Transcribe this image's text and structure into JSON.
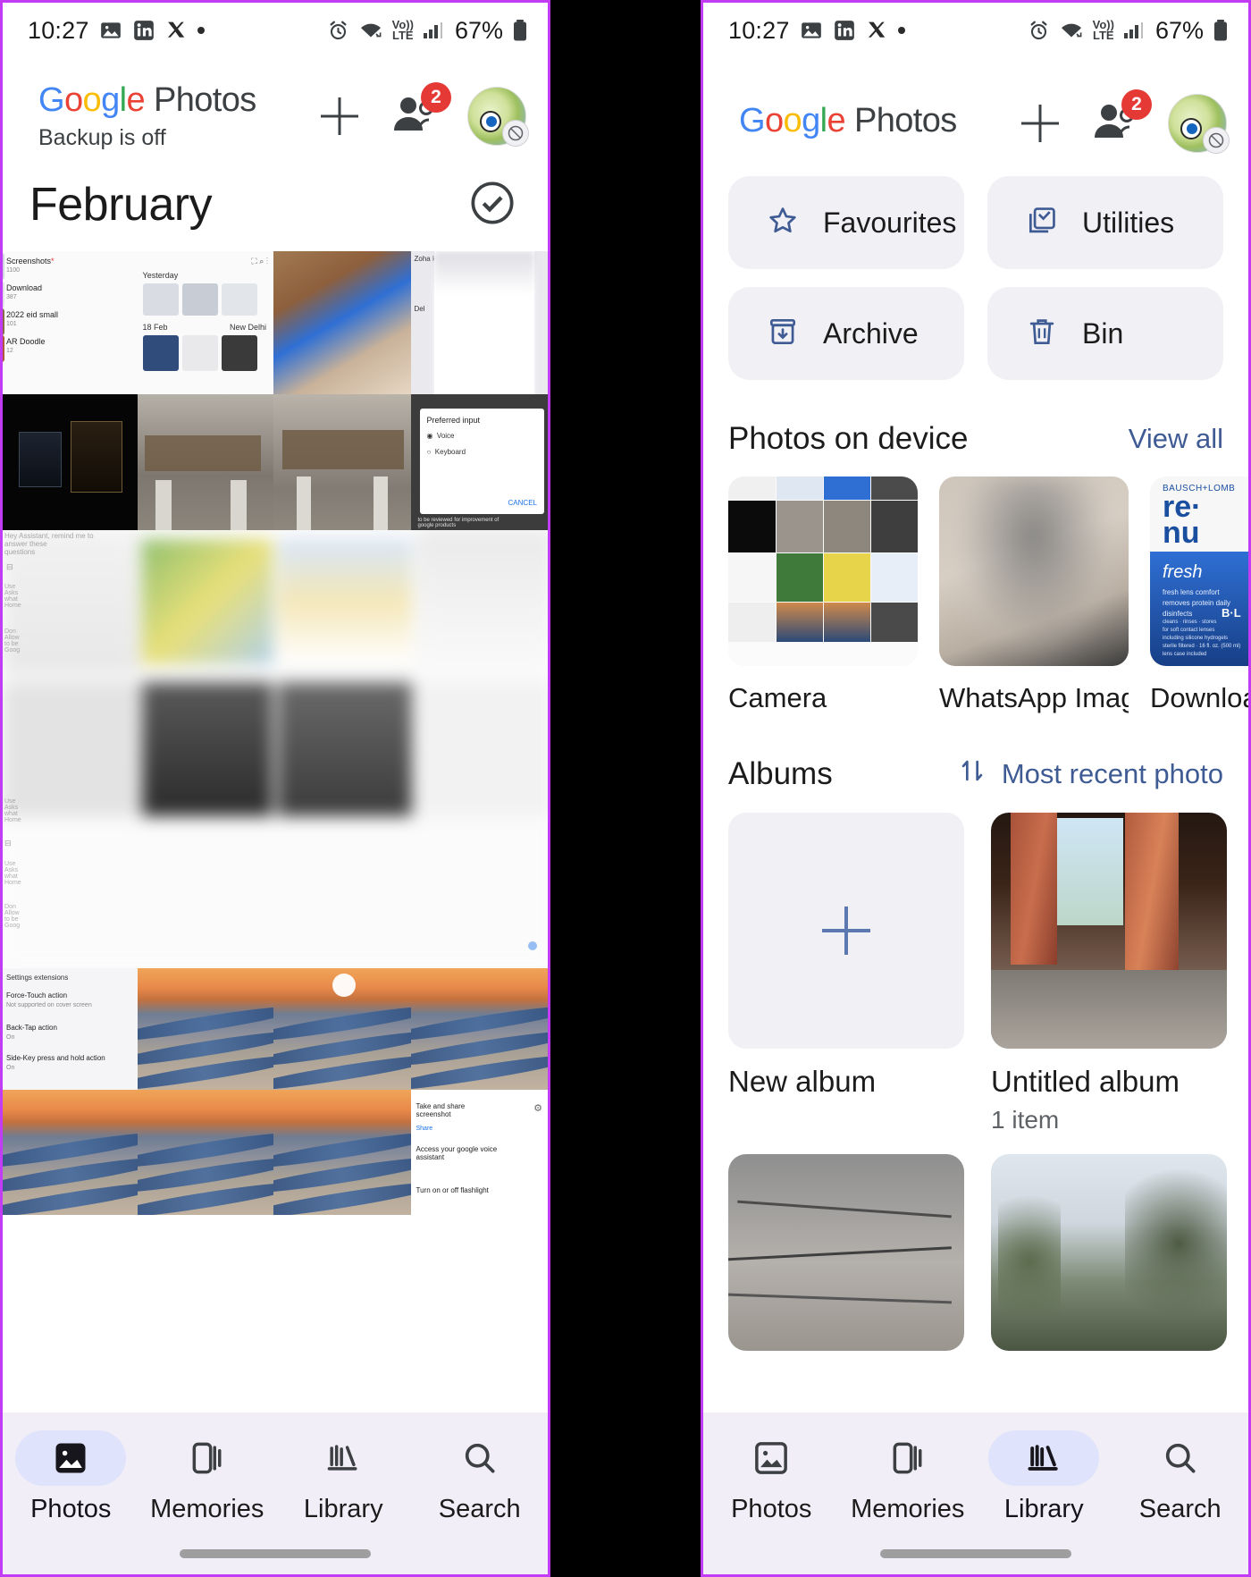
{
  "statusbar": {
    "time": "10:27",
    "battery_percent": "67%",
    "network_label": "LTE",
    "volte_label": "Vo))",
    "icons": [
      "photos-notification-icon",
      "linkedin-icon",
      "x-twitter-icon",
      "more-dot-icon",
      "alarm-icon",
      "wifi-icon",
      "volte-icon",
      "signal-icon",
      "battery-icon"
    ]
  },
  "appbar": {
    "brand_google": "Google",
    "brand_product": "Photos",
    "backup_status": "Backup is off",
    "add_label": "+",
    "share_badge": "2"
  },
  "left_panel": {
    "month_title": "February",
    "select_icon": "check-circle-icon",
    "tiles": [
      {
        "name": "screenshots-folder-list",
        "labels": [
          "Screenshots",
          "1100",
          "Download",
          "387",
          "2022 eid small",
          "101",
          "AR Doodle",
          "12"
        ]
      },
      {
        "name": "photos-grid-screenshot",
        "labels": [
          "Yesterday",
          "18 Feb",
          "New Delhi"
        ]
      },
      {
        "name": "blue-bag-photo",
        "labels": []
      },
      {
        "name": "chat-screenshot",
        "labels": [
          "Zoho h...",
          "Del"
        ]
      },
      {
        "name": "perfume-box-photo",
        "labels": []
      },
      {
        "name": "construction-site-photo",
        "labels": []
      },
      {
        "name": "construction-site-photo-2",
        "labels": []
      },
      {
        "name": "preferred-input-dialog",
        "labels": [
          "Preferred input",
          "Voice",
          "Keyboard",
          "CANCEL"
        ]
      },
      {
        "name": "blurred-settings-screenshot",
        "labels": []
      },
      {
        "name": "settings-extension-screenshot",
        "labels": [
          "Settings extensions",
          "Force-Touch action",
          "Not supported on cover screen",
          "Back-Tap action",
          "On",
          "Side-Key press and hold action",
          "On"
        ]
      },
      {
        "name": "beach-sunset-photo",
        "labels": []
      },
      {
        "name": "beach-sunset-photo-2",
        "labels": []
      },
      {
        "name": "beach-sunset-photo-3",
        "labels": []
      },
      {
        "name": "beach-sunset-photo-4",
        "labels": []
      },
      {
        "name": "beach-sunset-photo-5",
        "labels": []
      },
      {
        "name": "beach-sunset-photo-6",
        "labels": []
      },
      {
        "name": "assistant-options-screenshot",
        "labels": [
          "Take and share screenshot",
          "Share",
          "Access your google voice assistant",
          "Turn on or off flashlight"
        ]
      }
    ]
  },
  "right_panel": {
    "chips": [
      {
        "label": "Favourites",
        "icon": "star-icon"
      },
      {
        "label": "Utilities",
        "icon": "utilities-checkbox-icon"
      },
      {
        "label": "Archive",
        "icon": "archive-icon"
      },
      {
        "label": "Bin",
        "icon": "trash-icon"
      }
    ],
    "device_section": {
      "title": "Photos on device",
      "action": "View all",
      "items": [
        {
          "name": "Camera"
        },
        {
          "name": "WhatsApp Imag..."
        },
        {
          "name": "Downloa"
        }
      ]
    },
    "albums_section": {
      "title": "Albums",
      "sort_label": "Most recent photo",
      "sort_icon": "sort-arrows-icon",
      "items": [
        {
          "name": "New album",
          "subtitle": "",
          "thumb": "new-album-plus"
        },
        {
          "name": "Untitled album",
          "subtitle": "1 item",
          "thumb": "curtain-window-photo"
        },
        {
          "name": "",
          "subtitle": "",
          "thumb": "rock-texture-photo"
        },
        {
          "name": "",
          "subtitle": "",
          "thumb": "trees-sky-photo"
        }
      ]
    }
  },
  "bottomnav": {
    "left_active": "Photos",
    "right_active": "Library",
    "items": [
      {
        "label": "Photos",
        "icon": "photos-icon"
      },
      {
        "label": "Memories",
        "icon": "memories-icon"
      },
      {
        "label": "Library",
        "icon": "library-icon"
      },
      {
        "label": "Search",
        "icon": "search-icon"
      }
    ]
  },
  "colors": {
    "accent_blue": "#4285F4",
    "badge_red": "#e53935",
    "chip_bg": "#f0f0f5",
    "nav_bg": "#f1eef7",
    "nav_active_pill": "#dfe3fb",
    "link_blue": "#3f5b94",
    "frame_purple": "#c13cf4"
  }
}
